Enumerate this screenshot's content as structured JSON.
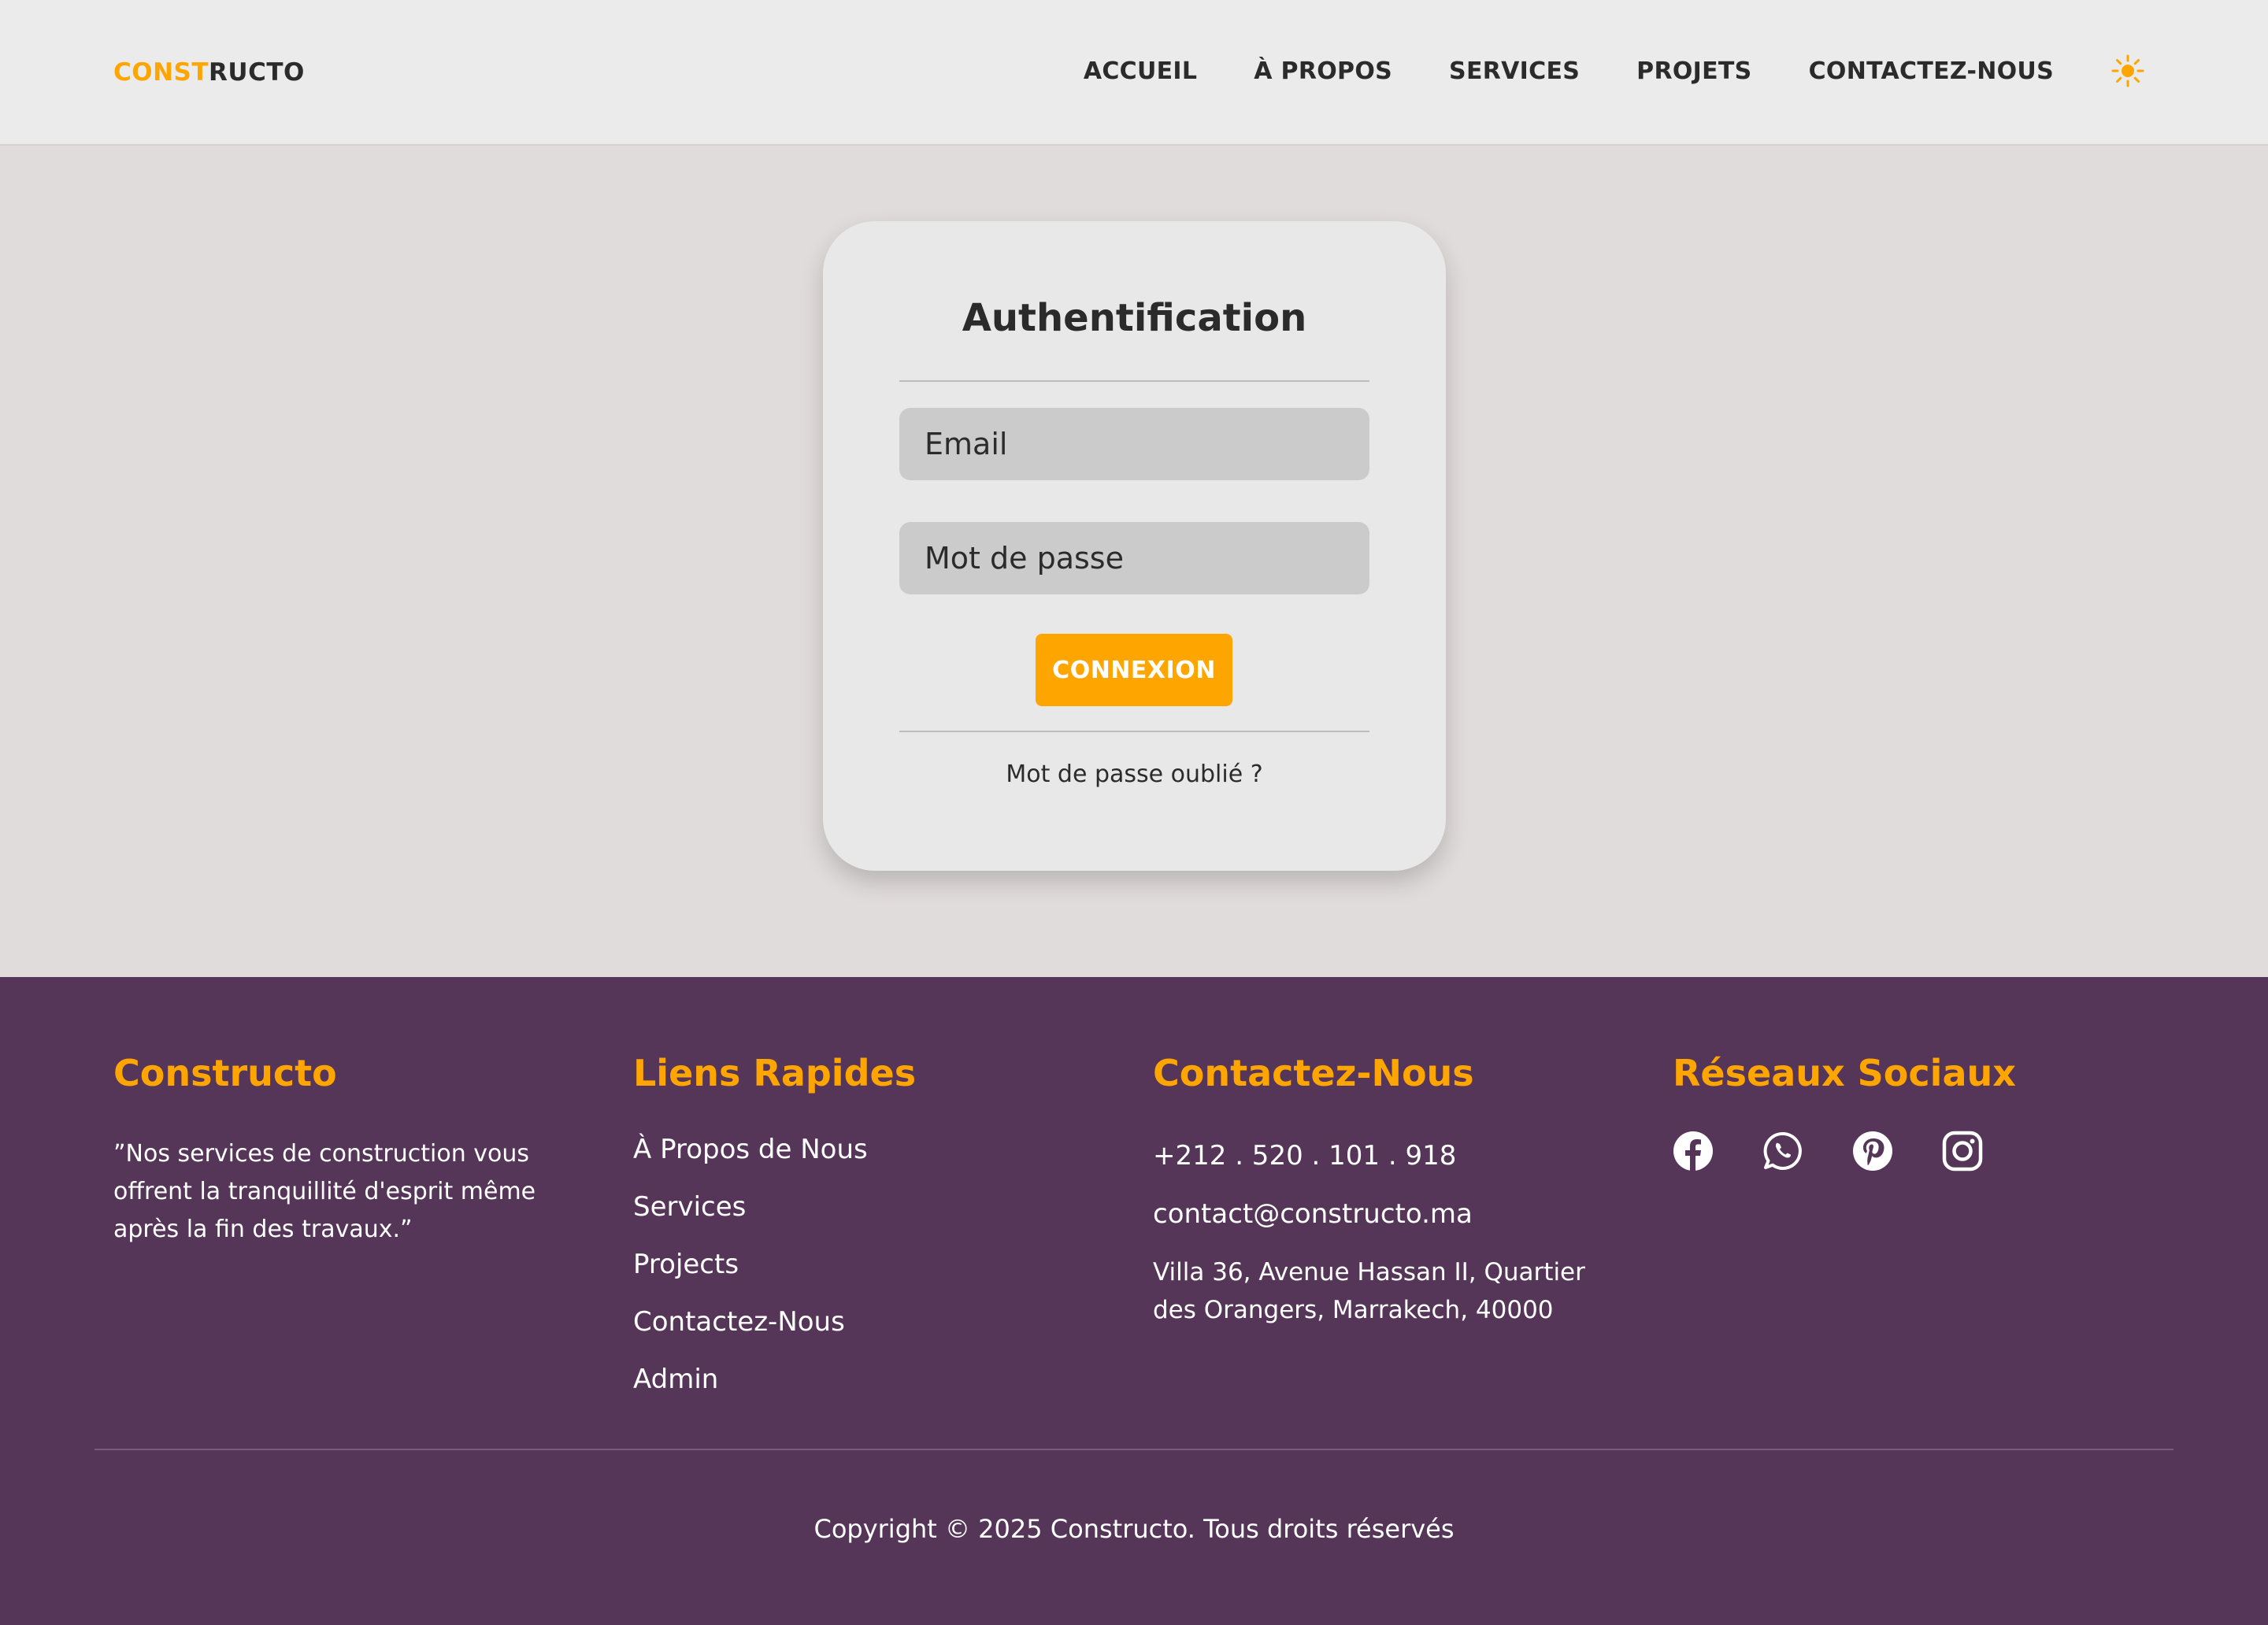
{
  "header": {
    "logo_accent": "CONST",
    "logo_rest": "RUCTO",
    "nav": {
      "home": "ACCUEIL",
      "about": "À PROPOS",
      "services": "SERVICES",
      "projects": "PROJETS",
      "contact": "CONTACTEZ-NOUS"
    },
    "theme_icon": "sun-icon",
    "accent_color": "#ffa500"
  },
  "auth": {
    "title": "Authentification",
    "email_placeholder": "Email",
    "password_placeholder": "Mot de passe",
    "submit_label": "CONNEXION",
    "forgot_label": "Mot de passe oublié ?"
  },
  "footer": {
    "background_color": "#563658",
    "brand": {
      "title": "Constructo",
      "quote": "”Nos services de construction vous offrent la tranquillité d'esprit même après la fin des travaux.”"
    },
    "quick_links": {
      "title": "Liens Rapides",
      "items": [
        "À Propos de Nous",
        "Services",
        "Projects",
        "Contactez-Nous",
        "Admin"
      ]
    },
    "contact": {
      "title": "Contactez-Nous",
      "phone": "+212 . 520 . 101 . 918",
      "email": "contact@constructo.ma",
      "address": "Villa 36, Avenue Hassan II, Quartier des Orangers, Marrakech, 40000"
    },
    "social": {
      "title": "Réseaux Sociaux",
      "icons": [
        "facebook-icon",
        "whatsapp-icon",
        "pinterest-icon",
        "instagram-icon"
      ]
    },
    "copyright": "Copyright © 2025 Constructo. Tous droits réservés"
  }
}
